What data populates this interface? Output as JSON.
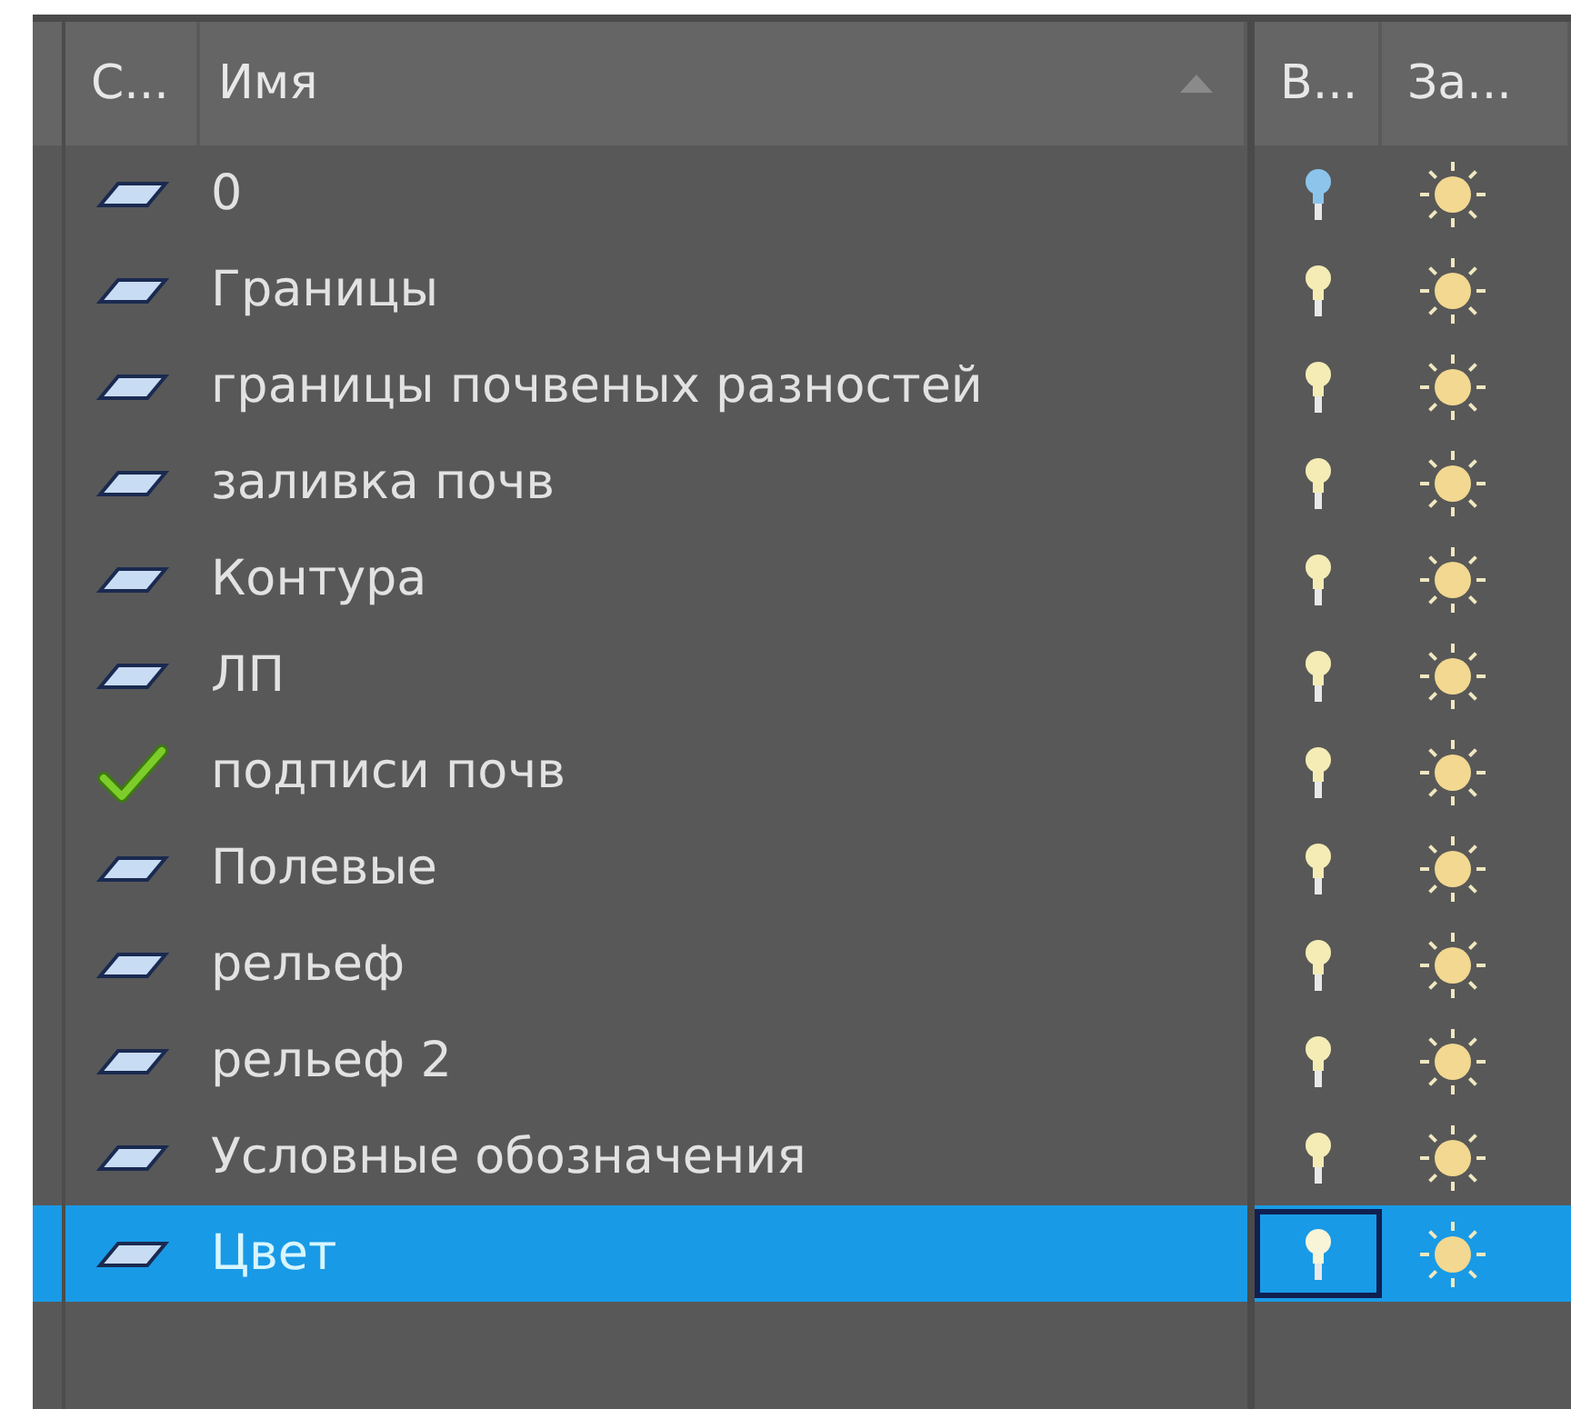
{
  "columns": [
    {
      "label": "С..."
    },
    {
      "label": "Имя",
      "sorted": true
    },
    {
      "label": "В..."
    },
    {
      "label": "За..."
    }
  ],
  "layers": [
    {
      "name": "0",
      "kind": "layer",
      "selected": false,
      "bulb": {
        "on": true,
        "color": "#8cc4ec",
        "focused": false
      }
    },
    {
      "name": "Границы",
      "kind": "layer",
      "selected": false,
      "bulb": {
        "on": true,
        "color": "#f4ecb4",
        "focused": false
      }
    },
    {
      "name": "границы почвеных разностей",
      "kind": "layer",
      "selected": false,
      "bulb": {
        "on": true,
        "color": "#f4ecb4",
        "focused": false
      }
    },
    {
      "name": "заливка почв",
      "kind": "layer",
      "selected": false,
      "bulb": {
        "on": true,
        "color": "#f4ecb4",
        "focused": false
      }
    },
    {
      "name": "Контура",
      "kind": "layer",
      "selected": false,
      "bulb": {
        "on": true,
        "color": "#f4ecb4",
        "focused": false
      }
    },
    {
      "name": "ЛП",
      "kind": "layer",
      "selected": false,
      "bulb": {
        "on": true,
        "color": "#f4ecb4",
        "focused": false
      }
    },
    {
      "name": "подписи почв",
      "kind": "current",
      "selected": false,
      "bulb": {
        "on": true,
        "color": "#f4ecb4",
        "focused": false
      }
    },
    {
      "name": "Полевые",
      "kind": "layer",
      "selected": false,
      "bulb": {
        "on": true,
        "color": "#f4ecb4",
        "focused": false
      }
    },
    {
      "name": "рельеф",
      "kind": "layer",
      "selected": false,
      "bulb": {
        "on": true,
        "color": "#f4ecb4",
        "focused": false
      }
    },
    {
      "name": "рельеф 2",
      "kind": "layer",
      "selected": false,
      "bulb": {
        "on": true,
        "color": "#f4ecb4",
        "focused": false
      }
    },
    {
      "name": "Условные обозначения",
      "kind": "layer",
      "selected": false,
      "bulb": {
        "on": true,
        "color": "#f4ecb4",
        "focused": false
      }
    },
    {
      "name": "Цвет",
      "kind": "layer",
      "selected": true,
      "bulb": {
        "on": true,
        "color": "#f8f4d8",
        "focused": true
      }
    }
  ]
}
